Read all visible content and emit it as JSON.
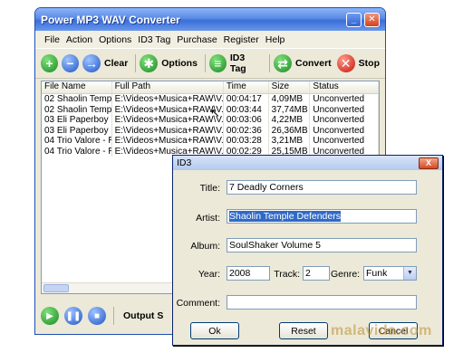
{
  "window": {
    "title": "Power MP3 WAV Converter",
    "min": "_",
    "close": "✕"
  },
  "menu": [
    "File",
    "Action",
    "Options",
    "ID3 Tag",
    "Purchase",
    "Register",
    "Help"
  ],
  "toolbar": {
    "add": "+",
    "remove": "−",
    "move": "→",
    "clear": "Clear",
    "options": "Options",
    "id3": "ID3 Tag",
    "convert": "Convert",
    "stop": "Stop"
  },
  "table": {
    "columns": [
      "File Name",
      "Full Path",
      "Time",
      "Size",
      "Status"
    ],
    "rows": [
      [
        "02 Shaolin Templ...",
        "E:\\Videos+Musica+RAW\\V...",
        "00:04:17",
        "4,09MB",
        "Unconverted"
      ],
      [
        "02 Shaolin Templ...",
        "E:\\Videos+Musica+RAW\\V...",
        "00:03:44",
        "37,74MB",
        "Unconverted"
      ],
      [
        "03 Eli Paperboy R...",
        "E:\\Videos+Musica+RAW\\V...",
        "00:03:06",
        "4,22MB",
        "Unconverted"
      ],
      [
        "03 Eli Paperboy R...",
        "E:\\Videos+Musica+RAW\\V...",
        "00:02:36",
        "26,36MB",
        "Unconverted"
      ],
      [
        "04 Trio Valore - R...",
        "E:\\Videos+Musica+RAW\\V...",
        "00:03:28",
        "3,21MB",
        "Unconverted"
      ],
      [
        "04 Trio Valore - R...",
        "E:\\Videos+Musica+RAW\\V...",
        "00:02:29",
        "25,15MB",
        "Unconverted"
      ]
    ]
  },
  "bottom": {
    "output_label": "Output S"
  },
  "dialog": {
    "title": "ID3",
    "close": "X",
    "title_label": "Title:",
    "title_value": "7 Deadly Corners",
    "artist_label": "Artist:",
    "artist_value": "Shaolin Temple Defenders",
    "album_label": "Album:",
    "album_value": "SoulShaker Volume 5",
    "year_label": "Year:",
    "year_value": "2008",
    "track_label": "Track:",
    "track_value": "2",
    "genre_label": "Genre:",
    "genre_value": "Funk",
    "comment_label": "Comment:",
    "comment_value": "",
    "ok": "Ok",
    "reset": "Reset",
    "cancel": "Cancel"
  },
  "watermark": "malavida.com"
}
